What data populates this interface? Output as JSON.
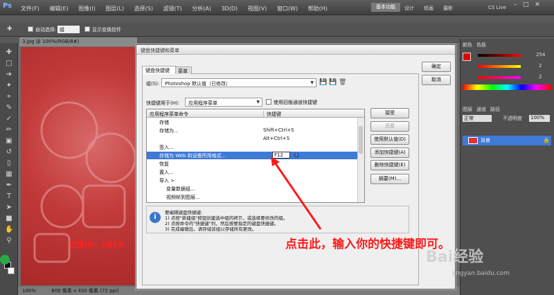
{
  "app": {
    "logo": "Ps",
    "menus": [
      "文件(F)",
      "编辑(E)",
      "图像(I)",
      "图层(L)",
      "选择(S)",
      "滤镜(T)",
      "分析(A)",
      "3D(D)",
      "视图(V)",
      "窗口(W)",
      "帮助(H)"
    ],
    "workspace_buttons": [
      "基本功能",
      "设计",
      "绘画",
      "摄影"
    ],
    "cs_live": "CS Live",
    "options": {
      "auto_select_label": "自动选择:",
      "auto_select_value": "组",
      "show_transform_label": "显示变换控件"
    },
    "doc_tab": "3.jpg @ 100%(RGB/8#)",
    "status": {
      "zoom": "100%",
      "size": "800 像素 x 430 像素 (72 ppi)"
    },
    "right_panel": {
      "tabs": [
        "颜色",
        "色板"
      ],
      "values": [
        "254",
        "2",
        "2"
      ],
      "layers_tabs": [
        "图层",
        "通道",
        "路径"
      ],
      "blend_mode": "正常",
      "opacity_label": "不透明度",
      "opacity_value": "100%",
      "layer_name": "背景"
    },
    "photo_watermark": "百度ID：ABC9"
  },
  "dialog": {
    "title": "键盘快捷键和菜单",
    "tabs": [
      "键盘快捷键",
      "菜单"
    ],
    "set_label": "组(S):",
    "set_value": "Photoshop 默认值（已修改）",
    "shortcuts_for_label": "快捷键用于(H):",
    "shortcuts_for_value": "应用程序菜单",
    "legacy_checkbox": "使用旧版通道快捷键",
    "columns": [
      "应用程序菜单命令",
      "快捷键"
    ],
    "rows": [
      {
        "cmd": "存储",
        "sc": "",
        "indent": 1
      },
      {
        "cmd": "存储为...",
        "sc": "Shift+Ctrl+S",
        "indent": 1
      },
      {
        "cmd": "",
        "sc": "Alt+Ctrl+S",
        "indent": 1
      },
      {
        "cmd": "签入...",
        "sc": "",
        "indent": 1
      },
      {
        "cmd": "存储为 Web 和设备所用格式...",
        "sc": "F12",
        "indent": 1,
        "selected": true
      },
      {
        "cmd": "恢复",
        "sc": "",
        "indent": 1
      },
      {
        "cmd": "置入...",
        "sc": "",
        "indent": 1
      },
      {
        "cmd": "导入 >",
        "sc": "",
        "indent": 1
      },
      {
        "cmd": "变量数据组...",
        "sc": "",
        "indent": 2
      },
      {
        "cmd": "视频帧到图层...",
        "sc": "",
        "indent": 2
      }
    ],
    "buttons": {
      "ok": "确定",
      "cancel": "取消",
      "accept": "接受",
      "undo": "还原",
      "use_default": "使用默认值(D)",
      "add": "添加快捷键(A)",
      "delete": "删除快捷键(E)",
      "summarize": "摘要(M)..."
    },
    "info_lines": [
      "要编辑键盘快捷键:",
      "1) 点按\"新建组\"按钮创建选中组的拷贝，或选择要修改的组。",
      "2) 点按命令的\"快捷键\"列，然后按要指定的键盘快捷键。",
      "3) 完成编辑后，请存储该组以存储所有更改。"
    ]
  },
  "annotation": {
    "text": "点击此，输入你的快捷键即可。",
    "color": "#ff1a1a"
  },
  "baidu": {
    "mark": "Bai经验",
    "url": "jingyan.baidu.com"
  },
  "colors": {
    "selection": "#3e7ad6",
    "annotation": "#ff1a1a"
  }
}
